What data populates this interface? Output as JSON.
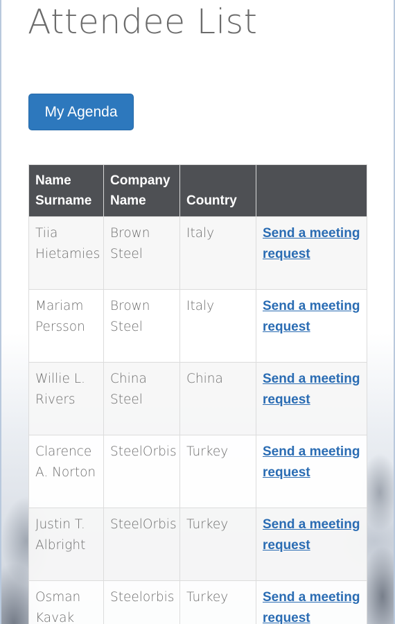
{
  "page": {
    "title": "Attendee List",
    "agenda_button": "My Agenda"
  },
  "table": {
    "headers": [
      "Name Surname",
      "Company Name",
      "Country",
      ""
    ],
    "rows": [
      {
        "name": "Tiia Hietamies",
        "company": "Brown Steel",
        "country": "Italy",
        "action": "Send a meeting request"
      },
      {
        "name": "Mariam Persson",
        "company": "Brown Steel",
        "country": "Italy",
        "action": "Send a meeting request"
      },
      {
        "name": "Willie L. Rivers",
        "company": "China Steel",
        "country": "China",
        "action": "Send a meeting request"
      },
      {
        "name": "Clarence A. Norton",
        "company": "SteelOrbis",
        "country": "Turkey",
        "action": "Send a meeting request"
      },
      {
        "name": "Justin T. Albright",
        "company": "SteelOrbis",
        "country": "Turkey",
        "action": "Send a meeting request"
      },
      {
        "name": "Osman Kavak",
        "company": "Steelorbis",
        "country": "Turkey",
        "action": "Send a meeting request"
      }
    ]
  },
  "colors": {
    "header_bg": "#4e5054",
    "button_bg": "#2d78bd",
    "link": "#2a6cb3"
  }
}
